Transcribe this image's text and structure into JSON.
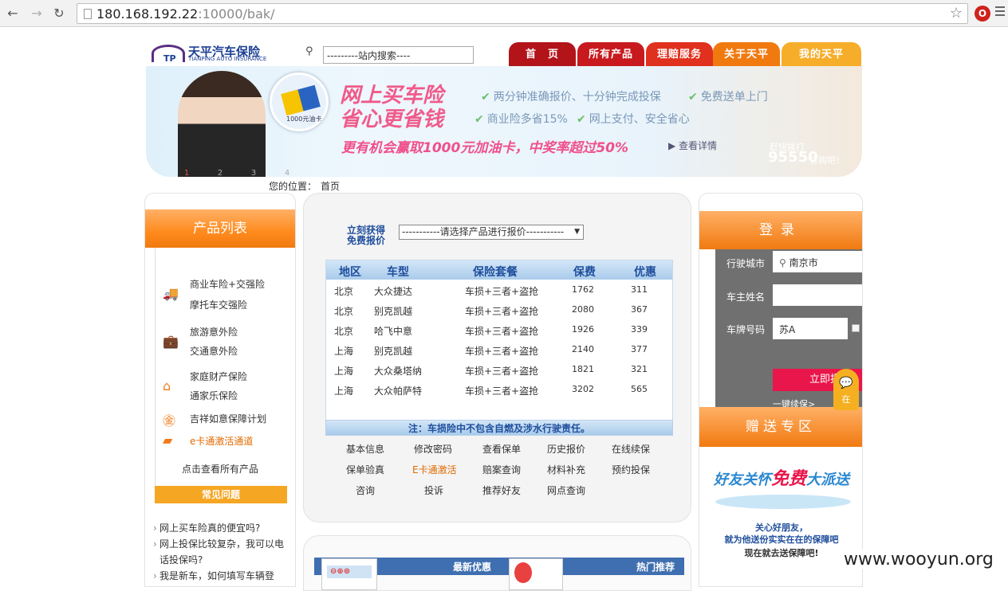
{
  "browser": {
    "url_host": "180.168.192.22",
    "url_rest": ":10000/bak/"
  },
  "logo": {
    "cn": "天平汽车保险",
    "en": "TIANPING AUTO INSURANCE",
    "mark": "TP"
  },
  "search": {
    "value": "---------站内搜索----"
  },
  "nav": {
    "tabs": [
      {
        "label": "首　页",
        "color": "#b3141a"
      },
      {
        "label": "所有产品",
        "color": "#c81a1e"
      },
      {
        "label": "理赔服务",
        "color": "#e0301e"
      },
      {
        "label": "关于天平",
        "color": "#f07a10"
      },
      {
        "label": "我的天平",
        "color": "#f6ad2a"
      }
    ]
  },
  "banner": {
    "headline1": "网上买车险",
    "headline2": "省心更省钱",
    "features": [
      "两分钟准确报价",
      "十分钟完成投保",
      "免费送单上门",
      "商业险多省15%",
      "网上支付",
      "安全省心"
    ],
    "card_text": "1000元油卡",
    "promo": "更有机会赢取1000元加油卡，中奖率超过50%",
    "detail": "查看详情",
    "hotline_label": "赶快拨打",
    "hotline": "95550",
    "hotline_suffix": "订购吧！",
    "pager": [
      "1",
      "2",
      "3",
      "4"
    ]
  },
  "breadcrumb": {
    "label": "您的位置：",
    "value": "首页"
  },
  "left": {
    "title": "产品列表",
    "items": [
      "商业车险+交强险",
      "摩托车交强险",
      "旅游意外险",
      "交通意外险",
      "家庭财产保险",
      "通家乐保险",
      "吉祥如意保障计划",
      "e卡通激活通道",
      "点击查看所有产品"
    ],
    "faq_title": "常见问题",
    "faq": [
      "网上买车险真的便宜吗?",
      "网上投保比较复杂，我可以电话投保吗?",
      "我是新车，如何填写车辆登"
    ]
  },
  "quote": {
    "label1": "立刻获得",
    "label2": "免费报价",
    "select": "-----------请选择产品进行报价-----------",
    "headers": [
      "地区",
      "车型",
      "保险套餐",
      "保费",
      "优惠"
    ],
    "rows": [
      [
        "北京",
        "大众捷达",
        "车损+三者+盗抢",
        "1762",
        "311"
      ],
      [
        "北京",
        "别克凯越",
        "车损+三者+盗抢",
        "2080",
        "367"
      ],
      [
        "北京",
        "哈飞中意",
        "车损+三者+盗抢",
        "1926",
        "339"
      ],
      [
        "上海",
        "别克凯越",
        "车损+三者+盗抢",
        "2140",
        "377"
      ],
      [
        "上海",
        "大众桑塔纳",
        "车损+三者+盗抢",
        "1821",
        "321"
      ],
      [
        "上海",
        "大众帕萨特",
        "车损+三者+盗抢",
        "3202",
        "565"
      ]
    ],
    "note": "注：车损险中不包含自燃及涉水行驶责任。"
  },
  "links": [
    [
      "基本信息",
      "修改密码",
      "查看保单",
      "历史报价",
      "在线续保"
    ],
    [
      "保单验真",
      "E卡通激活",
      "赔案查询",
      "材料补充",
      "预约投保"
    ],
    [
      "咨询",
      "投诉",
      "推荐好友",
      "网点查询"
    ]
  ],
  "bottom": {
    "tab1": "最新优惠",
    "tab2": "热门推荐"
  },
  "login": {
    "title": "登录",
    "city_label": "行驶城市",
    "city_value": "南京市",
    "owner_label": "车主姓名",
    "owner_value": "",
    "plate_label": "车牌号码",
    "plate_value": "苏A",
    "button": "立即报价",
    "renew": "一键续保>",
    "chat": "在"
  },
  "gift": {
    "title": "赠送专区",
    "slogan_a": "好友关怀",
    "slogan_b": "免费",
    "slogan_c": "大派送",
    "line1": "关心好朋友，",
    "line2": "就为他送份实实在在的保障吧",
    "line3": "现在就去送保障吧!"
  },
  "watermark": "www.wooyun.org"
}
